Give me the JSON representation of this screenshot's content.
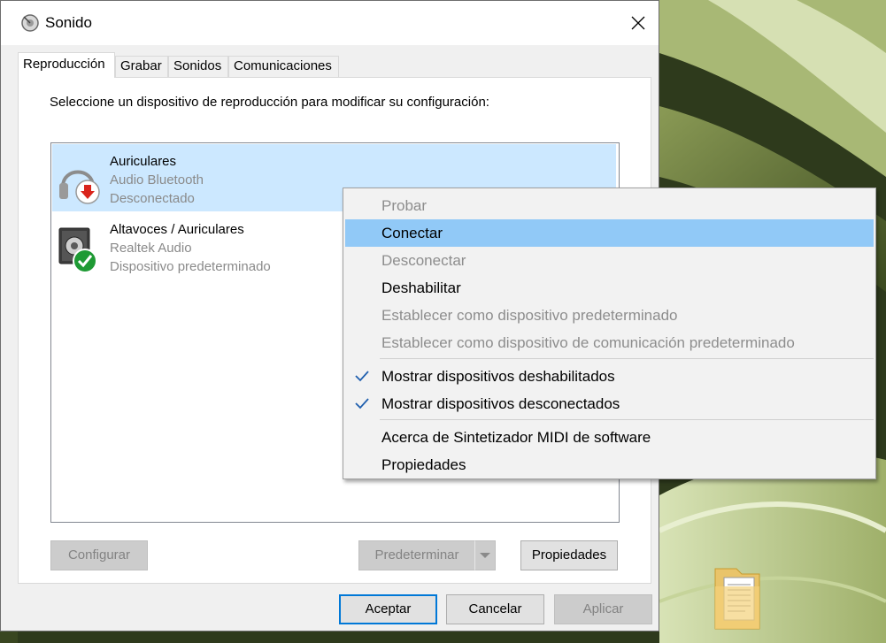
{
  "window": {
    "title": "Sonido",
    "tabs": [
      {
        "label": "Reproducción",
        "active": true
      },
      {
        "label": "Grabar",
        "active": false
      },
      {
        "label": "Sonidos",
        "active": false
      },
      {
        "label": "Comunicaciones",
        "active": false
      }
    ],
    "instruction": "Seleccione un dispositivo de reproducción para modificar su configuración:",
    "devices": [
      {
        "name": "Auriculares",
        "driver": "Audio Bluetooth",
        "status": "Desconectado",
        "selected": true,
        "icon": "headphones-disconnected-icon"
      },
      {
        "name": "Altavoces / Auriculares",
        "driver": "Realtek Audio",
        "status": "Dispositivo predeterminado",
        "selected": false,
        "icon": "speaker-default-icon"
      }
    ],
    "buttons": {
      "configure": "Configurar",
      "set_default": "Predeterminar",
      "properties": "Propiedades",
      "ok": "Aceptar",
      "cancel": "Cancelar",
      "apply": "Aplicar"
    }
  },
  "context_menu": {
    "items": [
      {
        "label": "Probar",
        "enabled": false
      },
      {
        "label": "Conectar",
        "enabled": true,
        "highlighted": true
      },
      {
        "label": "Desconectar",
        "enabled": false
      },
      {
        "label": "Deshabilitar",
        "enabled": true
      },
      {
        "label": "Establecer como dispositivo predeterminado",
        "enabled": false
      },
      {
        "label": "Establecer como dispositivo de comunicación predeterminado",
        "enabled": false
      },
      {
        "label": "Mostrar dispositivos deshabilitados",
        "enabled": true,
        "checked": true
      },
      {
        "label": "Mostrar dispositivos desconectados",
        "enabled": true,
        "checked": true
      },
      {
        "label": "Acerca de Sintetizador MIDI de software",
        "enabled": true
      },
      {
        "label": "Propiedades",
        "enabled": true
      }
    ]
  },
  "colors": {
    "selection": "#cce8ff",
    "menu_highlight": "#91c9f7",
    "accent": "#0078d7",
    "disabled_text": "#8d8d8d"
  }
}
